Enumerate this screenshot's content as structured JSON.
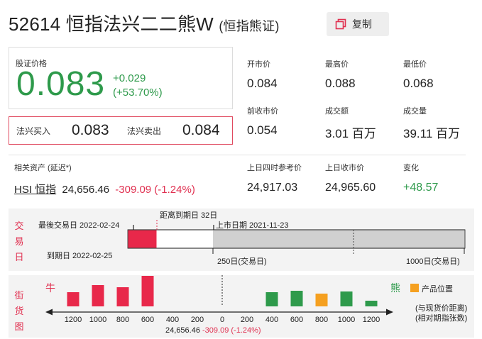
{
  "header": {
    "code": "52614",
    "name": "恒指法兴二二熊W",
    "subtitle": "(恒指熊证)",
    "copy_label": "复制"
  },
  "price": {
    "label": "股证价格",
    "value": "0.083",
    "change": "+0.029",
    "change_pct": "(+53.70%)"
  },
  "bidask": {
    "bid_label": "法兴买入",
    "bid": "0.083",
    "ask_label": "法兴卖出",
    "ask": "0.084"
  },
  "stats": [
    {
      "label": "开市价",
      "value": "0.084"
    },
    {
      "label": "最高价",
      "value": "0.088"
    },
    {
      "label": "最低价",
      "value": "0.068"
    },
    {
      "label": "前收市价",
      "value": "0.054"
    },
    {
      "label": "成交额",
      "value": "3.01 百万"
    },
    {
      "label": "成交量",
      "value": "39.11 百万"
    }
  ],
  "underlying": {
    "label": "相关资产 (延迟*)",
    "name": "HSI 恒指",
    "value": "24,656.46",
    "change": "-309.09 (-1.24%)",
    "ref_label": "上日四时参考价",
    "ref_value": "24,917.03",
    "close_label": "上日收市价",
    "close_value": "24,965.60",
    "diff_label": "变化",
    "diff_value": "+48.57"
  },
  "timeline": {
    "side_label": [
      "交",
      "易",
      "日"
    ],
    "last_trade": "最後交易日 2022-02-24",
    "days_to_expiry": "距离到期日 32日",
    "listing_date": "上市日期 2021-11-23",
    "expiry": "到期日 2022-02-25",
    "mark_250": "250日(交易日)",
    "mark_1000": "1000日(交易日)"
  },
  "street": {
    "side_label": [
      "街",
      "货",
      "图"
    ],
    "bull_label": "牛",
    "bear_label": "熊",
    "legend_label": "产品位置",
    "note_1": "(与现货价距离)",
    "note_2": "(相对期指张数)",
    "ticks": [
      "1200",
      "1000",
      "800",
      "600",
      "400",
      "200",
      "0",
      "200",
      "400",
      "600",
      "800",
      "1000",
      "1200"
    ],
    "spot_text": "24,656.46",
    "spot_change": "-309.09 (-1.24%)"
  },
  "chart_data": {
    "type": "bar",
    "categories": [
      "1200",
      "1000",
      "800",
      "600",
      "400",
      "200",
      "0",
      "200",
      "400",
      "600",
      "800",
      "1000",
      "1200"
    ],
    "series": [
      {
        "values": [
          20,
          30,
          27,
          43,
          0,
          0,
          0,
          0,
          0,
          0,
          0,
          0,
          0
        ]
      },
      {
        "values": [
          0,
          0,
          0,
          0,
          0,
          0,
          0,
          0,
          20,
          22,
          0,
          21,
          8
        ]
      },
      {
        "values": [
          0,
          0,
          0,
          0,
          0,
          0,
          0,
          0,
          0,
          0,
          18,
          0,
          0
        ]
      }
    ],
    "colors": {
      "bull": "#e8284a",
      "bear": "#2e9a4b",
      "product": "#f5a020"
    }
  },
  "colors": {
    "up": "#2e9a4b",
    "down": "#e03050",
    "accent_border": "#e04a60"
  }
}
